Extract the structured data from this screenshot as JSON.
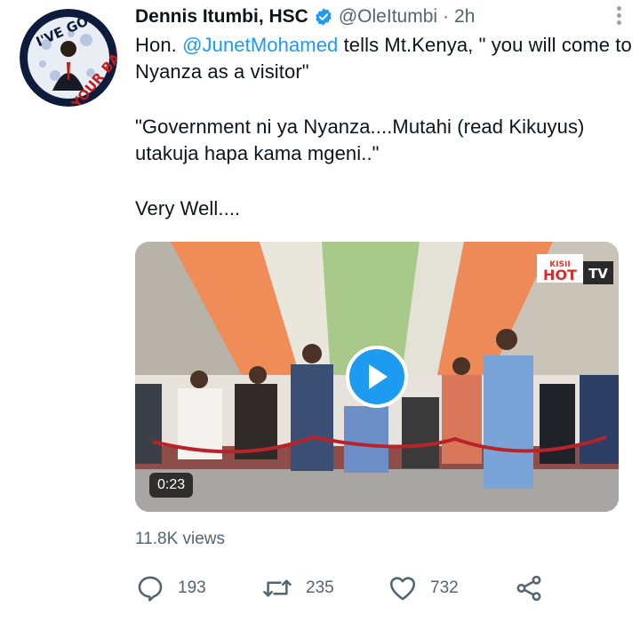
{
  "tweet": {
    "author_name": "Dennis Itumbi, HSC",
    "handle": "@OleItumbi",
    "separator": "·",
    "time": "2h",
    "text": {
      "line1_prefix": "Hon. ",
      "mention": "@JunetMohamed",
      "line1_suffix": " tells Mt.Kenya, \" you will come to Nyanza as a visitor\"",
      "para2": "\"Government ni ya Nyanza....Mutahi (read Kikuyus) utakuja hapa kama mgeni..\"",
      "para3": "Very Well...."
    },
    "avatar_text": {
      "top": "I'VE GOT",
      "bottom": "YOUR BACK"
    },
    "video": {
      "duration": "0:23",
      "watermark_brand": "KISII",
      "watermark_main": "HOT",
      "watermark_tv": "TV"
    },
    "views": "11.8K views",
    "stats": {
      "replies": "193",
      "retweets": "235",
      "likes": "732"
    }
  },
  "colors": {
    "accent": "#1d9bf0",
    "secondary_text": "#536471"
  },
  "icons": [
    "verified-badge-icon",
    "more-options-icon",
    "play-icon",
    "reply-icon",
    "retweet-icon",
    "like-icon",
    "share-icon"
  ]
}
